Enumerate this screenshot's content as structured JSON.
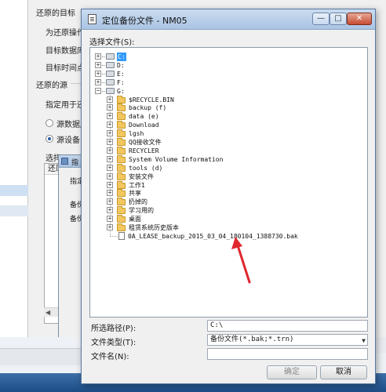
{
  "background_dialog": {
    "section_target": "还原的目标",
    "target_line1": "为还原操作选",
    "target_db_label": "目标数据库 (",
    "target_time_label": "目标时间点 (",
    "section_source": "还原的源",
    "source_intro": "指定用于还原",
    "radio_db_label": "源数据库",
    "radio_device_label": "源设备 (D",
    "select_label": "选择",
    "grid_header": "还原"
  },
  "mid_dialog": {
    "title": "指",
    "label1": "指定",
    "label2": "备份",
    "label3": "备份"
  },
  "dialog": {
    "title": "定位备份文件 - NM05",
    "select_file_label": "选择文件(S):",
    "controls": {
      "minimize": "—",
      "maximize": "□",
      "close": "✕"
    }
  },
  "tree": {
    "drives": [
      {
        "label": "C:",
        "expander": "+",
        "selected": true
      },
      {
        "label": "D:",
        "expander": "+"
      },
      {
        "label": "E:",
        "expander": "+"
      },
      {
        "label": "F:",
        "expander": "+"
      },
      {
        "label": "G:",
        "expander": "−"
      }
    ],
    "folders": [
      "$RECYCLE.BIN",
      "backup (f)",
      "data (e)",
      "Download",
      "lgsh",
      "QQ接收文件",
      "RECYCLER",
      "System Volume Information",
      "tools (d)",
      "安装文件",
      "工作1",
      "共享",
      "扔掉的",
      "学习用的",
      "桌面",
      "租赁系统历史版本"
    ],
    "file": "0A_LEASE_backup_2015_03_04_180104_1388730.bak"
  },
  "fields": {
    "path_label": "所选路径(P):",
    "path_value": "C:\\",
    "type_label": "文件类型(T):",
    "type_value": "备份文件(*.bak;*.trn)",
    "name_label": "文件名(N):",
    "name_value": ""
  },
  "buttons": {
    "ok": "确定",
    "cancel": "取消"
  },
  "colors": {
    "selection": "#3399ff",
    "annotation_arrow": "#e0272e"
  }
}
